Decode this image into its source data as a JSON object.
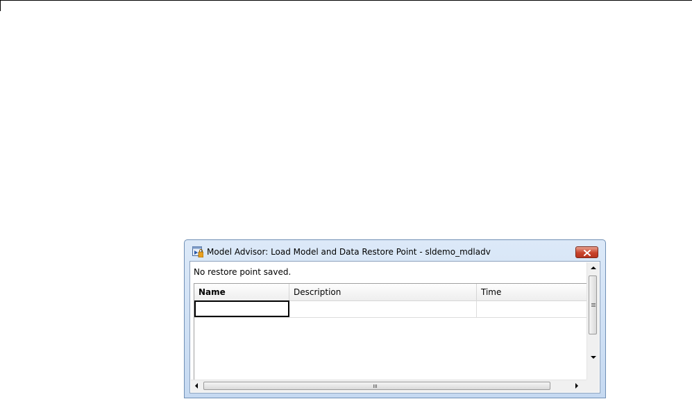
{
  "dialog": {
    "title": "Model Advisor: Load Model and Data Restore Point - sldemo_mdladv",
    "message": "No restore point saved.",
    "table": {
      "columns": [
        "Name",
        "Description",
        "Time"
      ],
      "rows": [
        [
          "",
          "",
          ""
        ]
      ]
    }
  },
  "icons": {
    "app": "model-advisor-restore-icon",
    "close": "close-icon"
  },
  "colors": {
    "close_button": "#c9452d",
    "titlebar": "#dce9f8"
  }
}
